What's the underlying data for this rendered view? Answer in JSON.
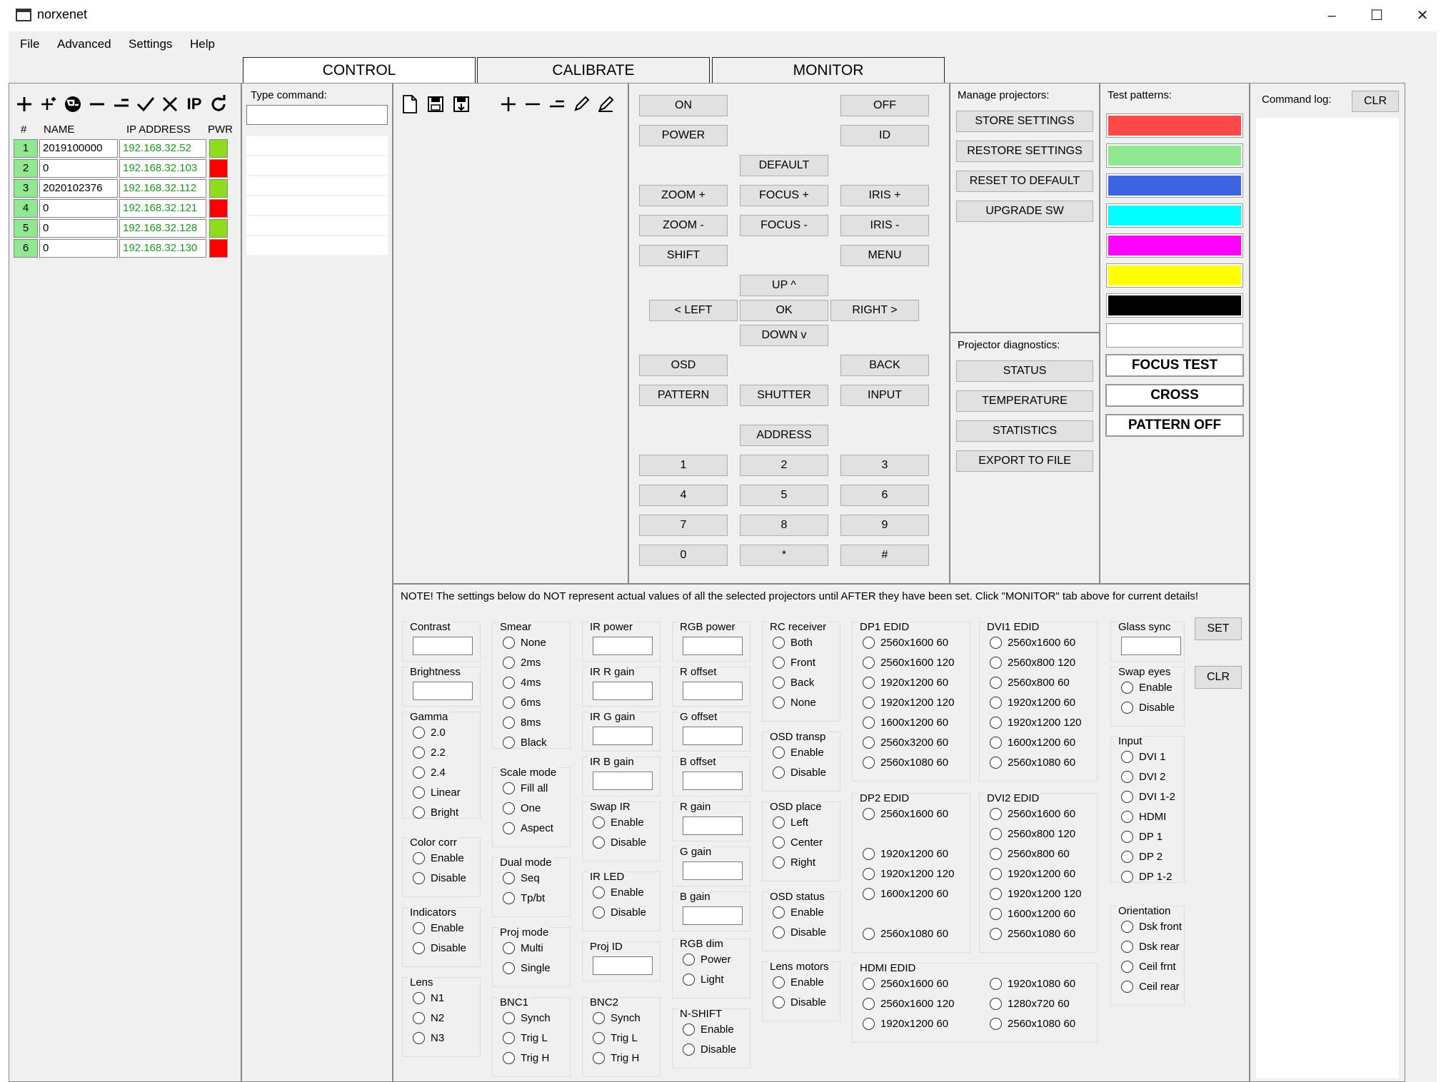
{
  "window": {
    "title": "norxenet",
    "controls": [
      "–",
      "☐",
      "✕"
    ]
  },
  "menu": [
    "File",
    "Advanced",
    "Settings",
    "Help"
  ],
  "tabs": [
    "CONTROL",
    "CALIBRATE",
    "MONITOR"
  ],
  "projectors": {
    "headers": {
      "num": "#",
      "name": "NAME",
      "ip": "IP ADDRESS",
      "pwr": "PWR"
    },
    "rows": [
      {
        "num": "1",
        "name": "2019100000",
        "ip": "192.168.32.52",
        "pwr": "#8fdc1a"
      },
      {
        "num": "2",
        "name": "0",
        "ip": "192.168.32.103",
        "pwr": "#ff0000"
      },
      {
        "num": "3",
        "name": "2020102376",
        "ip": "192.168.32.112",
        "pwr": "#8fdc1a"
      },
      {
        "num": "4",
        "name": "0",
        "ip": "192.168.32.121",
        "pwr": "#ff0000"
      },
      {
        "num": "5",
        "name": "0",
        "ip": "192.168.32.128",
        "pwr": "#8fdc1a"
      },
      {
        "num": "6",
        "name": "0",
        "ip": "192.168.32.130",
        "pwr": "#ff0000"
      }
    ]
  },
  "command": {
    "label": "Type command:"
  },
  "control": {
    "on": "ON",
    "off": "OFF",
    "power": "POWER",
    "id": "ID",
    "default": "DEFAULT",
    "zoom_plus": "ZOOM +",
    "focus_plus": "FOCUS +",
    "iris_plus": "IRIS +",
    "zoom_minus": "ZOOM -",
    "focus_minus": "FOCUS -",
    "iris_minus": "IRIS -",
    "shift": "SHIFT",
    "menu": "MENU",
    "up": "UP ^",
    "left": "< LEFT",
    "ok": "OK",
    "right": "RIGHT >",
    "down": "DOWN v",
    "osd": "OSD",
    "back": "BACK",
    "pattern": "PATTERN",
    "shutter": "SHUTTER",
    "input": "INPUT",
    "address": "ADDRESS",
    "keys": [
      "1",
      "2",
      "3",
      "4",
      "5",
      "6",
      "7",
      "8",
      "9",
      "0",
      "*",
      "#"
    ]
  },
  "manage": {
    "title": "Manage projectors:",
    "buttons": [
      "STORE SETTINGS",
      "RESTORE SETTINGS",
      "RESET TO DEFAULT",
      "UPGRADE SW"
    ]
  },
  "diagnostics": {
    "title": "Projector diagnostics:",
    "buttons": [
      "STATUS",
      "TEMPERATURE",
      "STATISTICS",
      "EXPORT TO FILE"
    ]
  },
  "test_patterns": {
    "title": "Test patterns:",
    "colors": [
      "#ff4848",
      "#90e890",
      "#3c64e0",
      "#00ffff",
      "#ff00ff",
      "#ffff00",
      "#000000",
      "#ffffff"
    ],
    "buttons": [
      "FOCUS TEST",
      "CROSS",
      "PATTERN OFF"
    ]
  },
  "command_log": {
    "label": "Command log:",
    "clr": "CLR"
  },
  "settings": {
    "note": "NOTE! The settings below do NOT represent actual values of all the selected projectors until AFTER they have been set. Click \"MONITOR\" tab above for current details!",
    "set": "SET",
    "clr": "CLR",
    "contrast": "Contrast",
    "brightness": "Brightness",
    "gamma": {
      "title": "Gamma",
      "opts": [
        "2.0",
        "2.2",
        "2.4",
        "Linear",
        "Bright"
      ]
    },
    "color_corr": {
      "title": "Color corr",
      "opts": [
        "Enable",
        "Disable"
      ]
    },
    "indicators": {
      "title": "Indicators",
      "opts": [
        "Enable",
        "Disable"
      ]
    },
    "lens": {
      "title": "Lens",
      "opts": [
        "N1",
        "N2",
        "N3"
      ]
    },
    "smear": {
      "title": "Smear",
      "opts": [
        "None",
        "2ms",
        "4ms",
        "6ms",
        "8ms",
        "Black"
      ]
    },
    "scale_mode": {
      "title": "Scale mode",
      "opts": [
        "Fill all",
        "One",
        "Aspect"
      ]
    },
    "dual_mode": {
      "title": "Dual mode",
      "opts": [
        "Seq",
        "Tp/bt"
      ]
    },
    "proj_mode": {
      "title": "Proj mode",
      "opts": [
        "Multi",
        "Single"
      ]
    },
    "bnc1": {
      "title": "BNC1",
      "opts": [
        "Synch",
        "Trig L",
        "Trig H"
      ]
    },
    "ir_power": "IR power",
    "ir_r_gain": "IR R gain",
    "ir_g_gain": "IR G gain",
    "ir_b_gain": "IR B gain",
    "swap_ir": {
      "title": "Swap IR",
      "opts": [
        "Enable",
        "Disable"
      ]
    },
    "ir_led": {
      "title": "IR LED",
      "opts": [
        "Enable",
        "Disable"
      ]
    },
    "proj_id": "Proj ID",
    "bnc2": {
      "title": "BNC2",
      "opts": [
        "Synch",
        "Trig L",
        "Trig H"
      ]
    },
    "rgb_power": "RGB power",
    "r_offset": "R offset",
    "g_offset": "G offset",
    "b_offset": "B offset",
    "r_gain": "R gain",
    "g_gain": "G gain",
    "b_gain": "B gain",
    "rgb_dim": {
      "title": "RGB dim",
      "opts": [
        "Power",
        "Light"
      ]
    },
    "n_shift": {
      "title": "N-SHIFT",
      "opts": [
        "Enable",
        "Disable"
      ]
    },
    "rc_receiver": {
      "title": "RC receiver",
      "opts": [
        "Both",
        "Front",
        "Back",
        "None"
      ]
    },
    "osd_transp": {
      "title": "OSD transp",
      "opts": [
        "Enable",
        "Disable"
      ]
    },
    "osd_place": {
      "title": "OSD place",
      "opts": [
        "Left",
        "Center",
        "Right"
      ]
    },
    "osd_status": {
      "title": "OSD status",
      "opts": [
        "Enable",
        "Disable"
      ]
    },
    "lens_motors": {
      "title": "Lens motors",
      "opts": [
        "Enable",
        "Disable"
      ]
    },
    "dp1_edid": {
      "title": "DP1 EDID",
      "opts": [
        "2560x1600 60",
        "2560x1600 120",
        "1920x1200 60",
        "1920x1200 120",
        "1600x1200 60",
        "2560x3200 60",
        "2560x1080 60"
      ]
    },
    "dvi1_edid": {
      "title": "DVI1 EDID",
      "opts": [
        "2560x1600 60",
        "2560x800 120",
        "2560x800 60",
        "1920x1200 60",
        "1920x1200 120",
        "1600x1200 60",
        "2560x1080 60"
      ]
    },
    "dp2_edid": {
      "title": "DP2 EDID",
      "opts": [
        "2560x1600 60",
        "1920x1200 60",
        "1920x1200 120",
        "1600x1200 60",
        "2560x1080 60"
      ]
    },
    "dvi2_edid": {
      "title": "DVI2 EDID",
      "opts": [
        "2560x1600 60",
        "2560x800 120",
        "2560x800 60",
        "1920x1200 60",
        "1920x1200 120",
        "1600x1200 60",
        "2560x1080 60"
      ]
    },
    "hdmi_edid": {
      "title": "HDMI EDID",
      "opts": [
        "2560x1600 60",
        "2560x1600 120",
        "1920x1200 60",
        "1920x1080 60",
        "1280x720 60",
        "2560x1080 60"
      ]
    },
    "glass_sync": "Glass sync",
    "swap_eyes": {
      "title": "Swap eyes",
      "opts": [
        "Enable",
        "Disable"
      ]
    },
    "input": {
      "title": "Input",
      "opts": [
        "DVI 1",
        "DVI 2",
        "DVI 1-2",
        "HDMI",
        "DP 1",
        "DP 2",
        "DP 1-2"
      ]
    },
    "orientation": {
      "title": "Orientation",
      "opts": [
        "Dsk front",
        "Dsk rear",
        "Ceil frnt",
        "Ceil rear"
      ]
    }
  }
}
